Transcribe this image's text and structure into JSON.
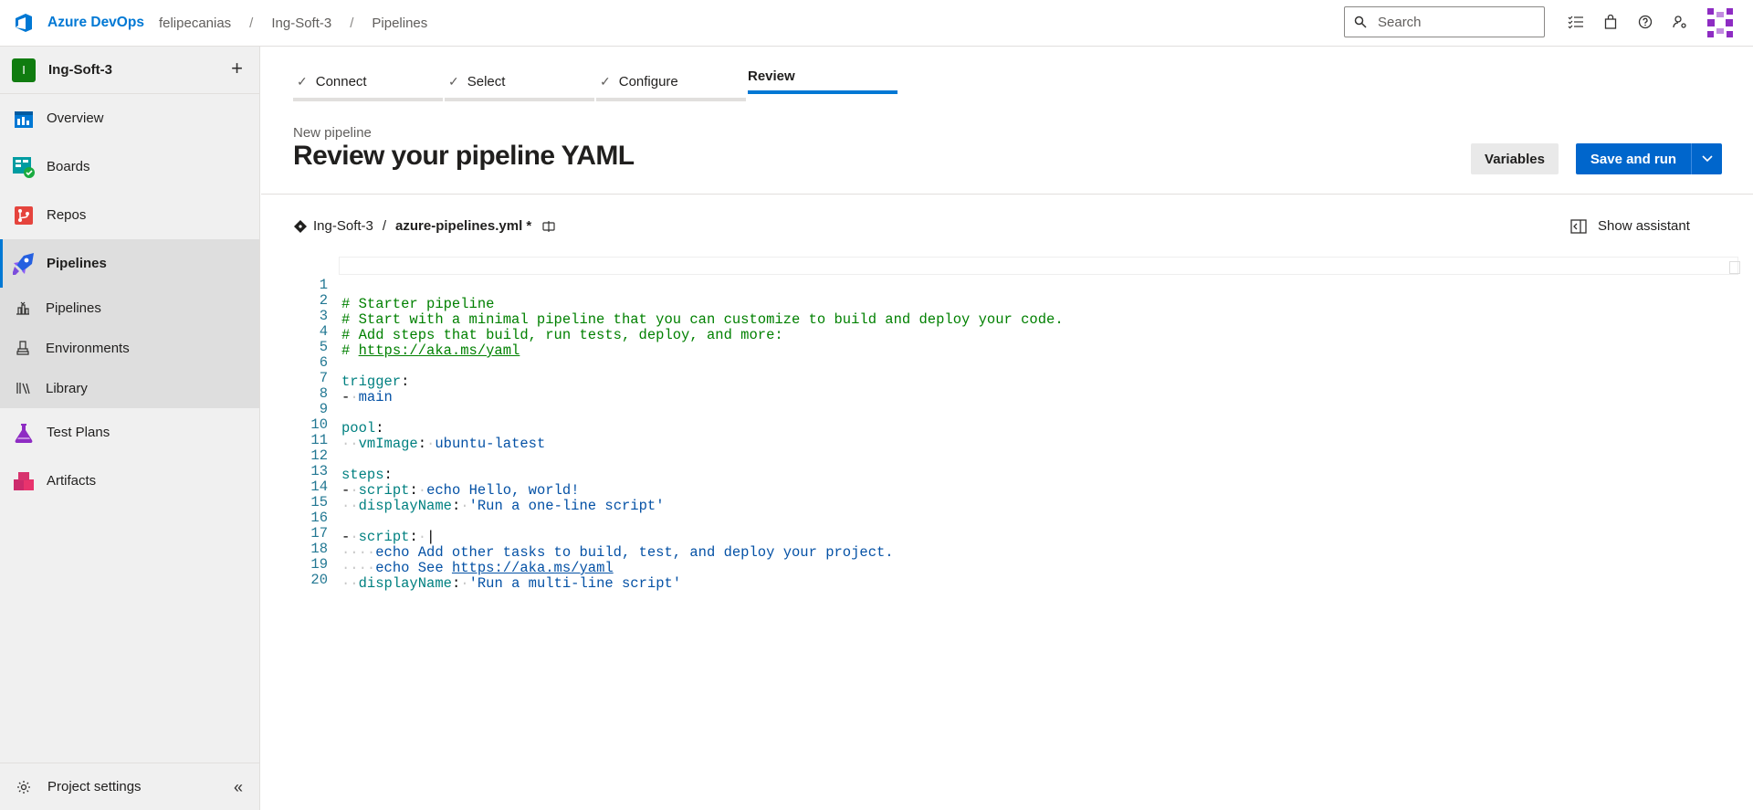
{
  "topbar": {
    "brand": "Azure DevOps",
    "breadcrumbs": [
      "felipecanias",
      "Ing-Soft-3",
      "Pipelines"
    ],
    "search_placeholder": "Search",
    "icons": [
      "task-list-icon",
      "shopping-bag-icon",
      "help-icon",
      "user-settings-icon"
    ]
  },
  "sidebar": {
    "project_initial": "I",
    "project_name": "Ing-Soft-3",
    "items": [
      {
        "label": "Overview",
        "icon": "overview-icon"
      },
      {
        "label": "Boards",
        "icon": "boards-icon"
      },
      {
        "label": "Repos",
        "icon": "repos-icon"
      },
      {
        "label": "Pipelines",
        "icon": "pipelines-icon",
        "active": true
      },
      {
        "label": "Test Plans",
        "icon": "test-plans-icon"
      },
      {
        "label": "Artifacts",
        "icon": "artifacts-icon"
      }
    ],
    "sub_items": [
      {
        "label": "Pipelines",
        "icon": "pipelines-sub-icon"
      },
      {
        "label": "Environments",
        "icon": "environments-icon"
      },
      {
        "label": "Library",
        "icon": "library-icon"
      }
    ],
    "settings_label": "Project settings"
  },
  "wizard": {
    "steps": [
      {
        "label": "Connect",
        "done": true
      },
      {
        "label": "Select",
        "done": true
      },
      {
        "label": "Configure",
        "done": true
      },
      {
        "label": "Review",
        "current": true
      }
    ]
  },
  "page": {
    "pre_title": "New pipeline",
    "title": "Review your pipeline YAML",
    "variables_label": "Variables",
    "save_run_label": "Save and run"
  },
  "file": {
    "repo": "Ing-Soft-3",
    "separator": "/",
    "name": "azure-pipelines.yml *",
    "assistant_label": "Show assistant"
  },
  "editor": {
    "line_numbers": [
      "1",
      "2",
      "3",
      "4",
      "5",
      "6",
      "7",
      "8",
      "9",
      "10",
      "11",
      "12",
      "13",
      "14",
      "15",
      "16",
      "17",
      "18",
      "19",
      "20"
    ],
    "lines": {
      "l1": "# Starter pipeline",
      "l2": "# Start with a minimal pipeline that you can customize to build and deploy your code.",
      "l3": "# Add steps that build, run tests, deploy, and more:",
      "l4_prefix": "# ",
      "l4_link": "https://aka.ms/yaml",
      "l6_key": "trigger",
      "l7_val": "main",
      "l9_key": "pool",
      "l10_key": "vmImage",
      "l10_val": "ubuntu-latest",
      "l12_key": "steps",
      "l13_key": "script",
      "l13_val": "echo Hello, world!",
      "l14_key": "displayName",
      "l14_val": "'Run a one-line script'",
      "l16_key": "script",
      "l16_val": "|",
      "l17_val": "echo Add other tasks to build, test, and deploy your project.",
      "l18_prefix": "echo See ",
      "l18_link": "https://aka.ms/yaml",
      "l19_key": "displayName",
      "l19_val": "'Run a multi-line script'"
    }
  }
}
